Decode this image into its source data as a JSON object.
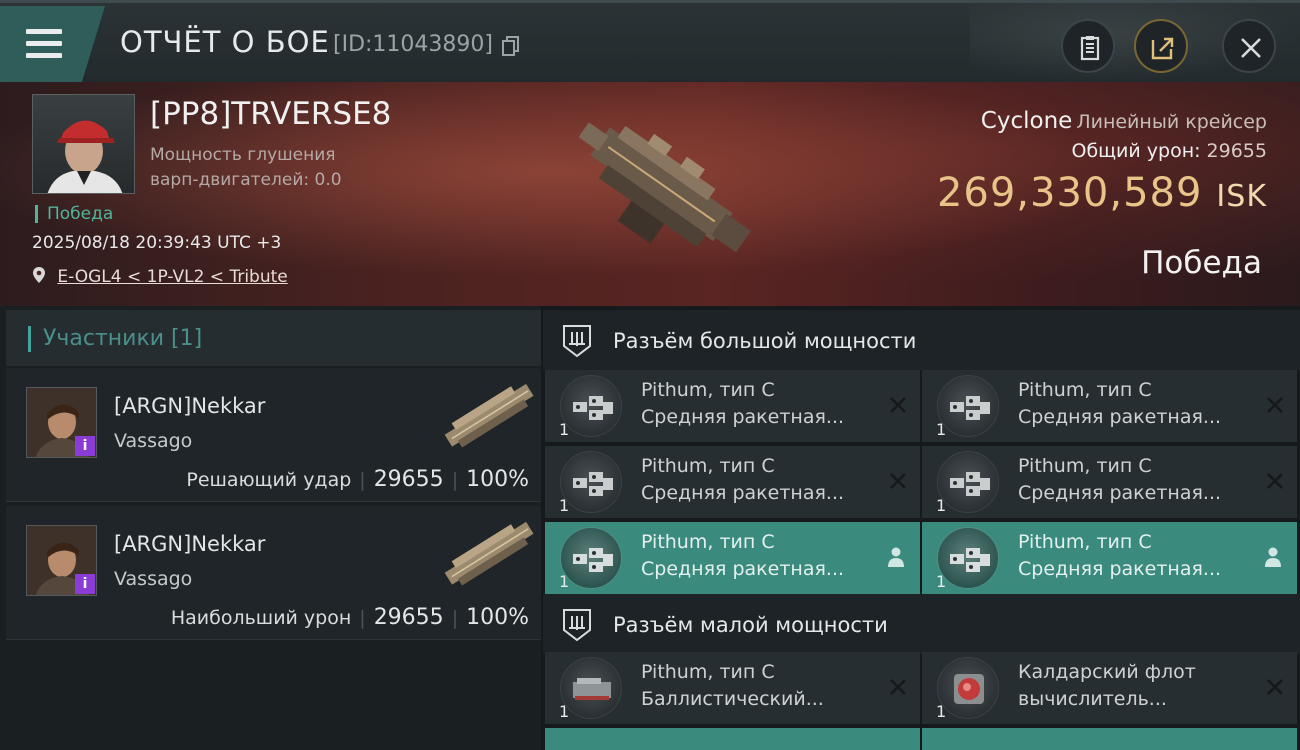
{
  "header": {
    "title": "ОТЧЁТ О БОЕ",
    "report_id": "[ID:11043890]",
    "icons": [
      "menu-icon",
      "copy-icon",
      "clipboard-icon",
      "share-icon",
      "close-icon"
    ],
    "accent_color": "#2f5d59"
  },
  "victim": {
    "name": "[PP8]TRVERSE8",
    "warp_jam_label": "Мощность глушения варп-двигателей: 0.0",
    "status": "Победа",
    "datetime": "2025/08/18 20:39:43 UTC +3",
    "location": "E-OGL4 < 1P-VL2 < Tribute",
    "ship_name": "Cyclone",
    "ship_class": "Линейный крейсер",
    "total_damage_label": "Общий урон:",
    "total_damage_value": "29655",
    "isk_value": "269,330,589",
    "isk_currency": "ISK",
    "result": "Победа"
  },
  "participants": {
    "header": "Участники [1]",
    "items": [
      {
        "name": "[ARGN]Nekkar",
        "ship": "Vassago",
        "role": "Решающий удар",
        "damage": "29655",
        "percent": "100%",
        "badge": "i"
      },
      {
        "name": "[ARGN]Nekkar",
        "ship": "Vassago",
        "role": "Наибольший урон",
        "damage": "29655",
        "percent": "100%",
        "badge": "i"
      }
    ]
  },
  "slots": {
    "high": {
      "title": "Разъём большой мощности",
      "modules": [
        {
          "name": "Pithum, тип C",
          "desc": "Средняя ракетная...",
          "qty": "1",
          "state": "destroyed"
        },
        {
          "name": "Pithum, тип C",
          "desc": "Средняя ракетная...",
          "qty": "1",
          "state": "destroyed"
        },
        {
          "name": "Pithum, тип C",
          "desc": "Средняя ракетная...",
          "qty": "1",
          "state": "destroyed"
        },
        {
          "name": "Pithum, тип C",
          "desc": "Средняя ракетная...",
          "qty": "1",
          "state": "destroyed"
        },
        {
          "name": "Pithum, тип C",
          "desc": "Средняя ракетная...",
          "qty": "1",
          "state": "dropped"
        },
        {
          "name": "Pithum, тип C",
          "desc": "Средняя ракетная...",
          "qty": "1",
          "state": "dropped"
        }
      ]
    },
    "mid": {
      "title": "Разъём малой мощности",
      "modules": [
        {
          "name": "Pithum, тип C",
          "desc": "Баллистический...",
          "qty": "1",
          "state": "destroyed"
        },
        {
          "name": "Калдарский флот",
          "desc": "вычислитель...",
          "qty": "1",
          "state": "destroyed"
        }
      ]
    }
  }
}
